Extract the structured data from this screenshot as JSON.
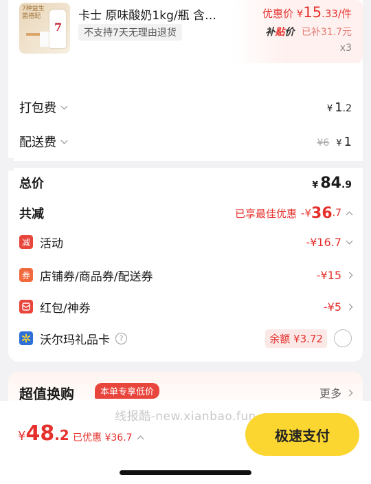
{
  "product": {
    "thumb_text": "7种益生菌搭配",
    "thumb_number": "7",
    "title": "卡士 原味酸奶1kg/瓶 含…",
    "return_policy": "不支持7天无理由退货",
    "discount_label": "优惠价",
    "currency": "¥",
    "price_int": "15",
    "price_dec": ".33",
    "unit": "/件",
    "subsidy_brand_1": "补",
    "subsidy_brand_2": "贴",
    "subsidy_brand_3": "价",
    "subsidy_amount": "已补31.7元",
    "quantity": "x3"
  },
  "fees": {
    "packaging": {
      "label": "打包费",
      "currency": "¥",
      "int": "1",
      "dec": ".2"
    },
    "delivery": {
      "label": "配送费",
      "original": "¥6",
      "currency": "¥",
      "int": "1"
    }
  },
  "summary": {
    "total_label": "总价",
    "total_currency": "¥",
    "total_int": "84",
    "total_dec": ".9",
    "reduce_label": "共减",
    "best_discount": "已享最佳优惠",
    "reduce_prefix": "-¥",
    "reduce_int": "36",
    "reduce_dec": ".7"
  },
  "discounts": [
    {
      "icon_text": "减",
      "label": "活动",
      "value": "-¥16.7"
    },
    {
      "icon_text": "券",
      "label": "店铺券/商品券/配送券",
      "value": "-¥15"
    },
    {
      "icon_text": "",
      "label": "红包/神券",
      "value": "-¥5"
    }
  ],
  "gift_card": {
    "label": "沃尔玛礼品卡",
    "help": "?",
    "balance": "余额 ¥3.72"
  },
  "exchange": {
    "title": "超值换购",
    "badge": "本单专享低价",
    "more": "更多"
  },
  "bottom": {
    "watermark": "线报酷-new.xianbao.fun",
    "currency": "¥",
    "pay_int": "48",
    "pay_dec": ".2",
    "saved": "已优惠 ¥36.7",
    "pay_button": "极速支付"
  },
  "colors": {
    "accent_red": "#e5302c",
    "pay_button": "#fbd530",
    "walmart_blue": "#2d6fd6"
  }
}
